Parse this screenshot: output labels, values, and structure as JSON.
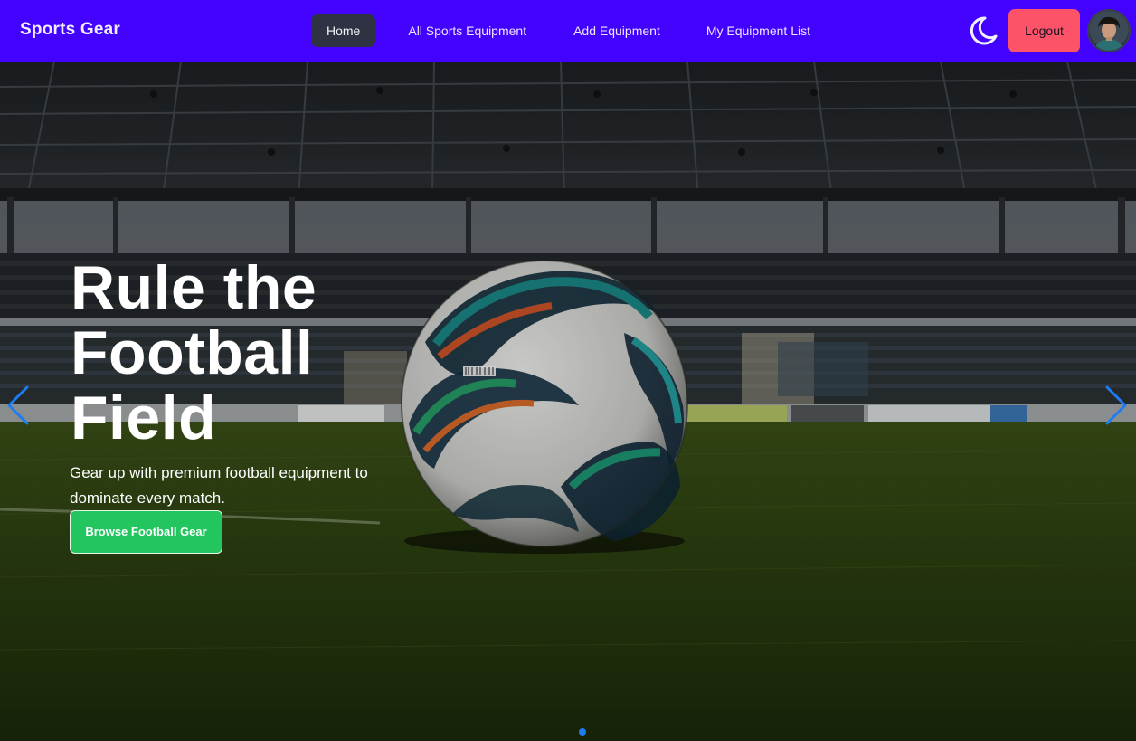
{
  "navbar": {
    "brand": "Sports Gear",
    "links": [
      {
        "label": "Home",
        "active": true
      },
      {
        "label": "All Sports Equipment",
        "active": false
      },
      {
        "label": "Add Equipment",
        "active": false
      },
      {
        "label": "My Equipment List",
        "active": false
      }
    ],
    "theme_toggle_icon": "moon-icon",
    "logout_label": "Logout",
    "avatar_icon": "user-avatar"
  },
  "hero": {
    "title": "Rule the Football Field",
    "subtitle": "Gear up with premium football equipment to dominate every match.",
    "cta_label": "Browse Football Gear",
    "prev_icon": "chevron-left-icon",
    "next_icon": "chevron-right-icon",
    "slide_count": 1,
    "active_slide": 1
  },
  "colors": {
    "navbar_bg": "#4301fe",
    "active_link_bg": "#2e3242",
    "logout_bg": "#fd5368",
    "cta_bg": "#22c55e",
    "arrow_color": "#1d7cf2"
  }
}
